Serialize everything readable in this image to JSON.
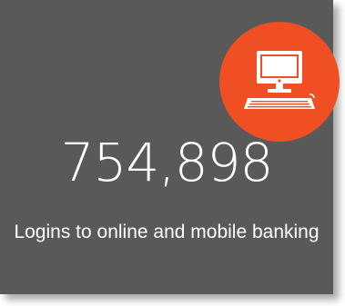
{
  "stat": {
    "value": "754,898",
    "label": "Logins to online and mobile banking"
  },
  "icon": {
    "name": "desktop-computer-icon"
  },
  "colors": {
    "card_background": "#595959",
    "accent": "#f04e23",
    "text": "#ffffff"
  }
}
